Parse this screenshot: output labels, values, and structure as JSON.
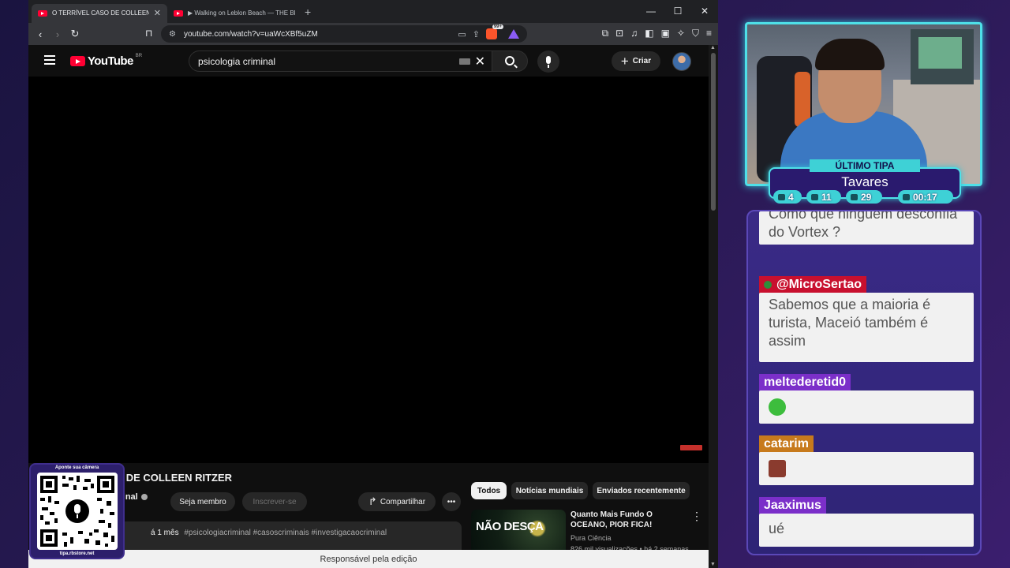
{
  "browser": {
    "tabs": [
      {
        "title": "O TERRÍVEL CASO DE COLLEEN RITZER",
        "active": true
      },
      {
        "title": "▶ Walking on Leblon Beach — THE BEST BE",
        "active": false
      }
    ],
    "url": "youtube.com/watch?v=uaWcXBf5uZM",
    "status_text": "Responsável pela edição"
  },
  "youtube": {
    "logo_text": "YouTube",
    "country": "BR",
    "search_value": "psicologia criminal",
    "create_label": "Criar",
    "video_title": "O DE COLLEEN RITZER",
    "channel_name": "minal",
    "member_button": "Seja membro",
    "subscribe_button": "Inscrever-se",
    "share_button": "Compartilhar",
    "more_button": "•••",
    "description_age": "á 1 mês",
    "description_tags": "#psicologiacriminal #casoscriminais #investigacaocriminal",
    "chips": [
      "Todos",
      "Notícias mundiais",
      "Enviados recentemente"
    ],
    "recommended": {
      "title": "Quanto Mais Fundo O OCEANO, PIOR FICA!",
      "channel": "Pura Ciência",
      "meta": "826 mil visualizações • há 2 semanas",
      "thumb_text": "NÃO DESÇA"
    }
  },
  "qr": {
    "top_label": "Aponte sua câmera",
    "bottom_label": "tipa.rbstore.net"
  },
  "overlay": {
    "tipa_label": "ÚLTIMO TIPA",
    "tipa_name": "Tavares",
    "stats": [
      {
        "icon": "chat-icon",
        "value": "4"
      },
      {
        "icon": "youtube-icon",
        "value": "11"
      },
      {
        "icon": "link-icon",
        "value": "29"
      },
      {
        "icon": "clock-icon",
        "value": "00:17"
      }
    ]
  },
  "chat": {
    "messages": [
      {
        "user": "",
        "text": "Como que ninguém desconfia do Vortex ?",
        "color": "#f1f1f1"
      },
      {
        "user": "@MicroSertao",
        "text": "Sabemos que a maioria é turista, Maceió também é assim",
        "color": "#c8102e"
      },
      {
        "user": "meltederetid0",
        "text": "",
        "emote": "green-frog-emote",
        "color": "#7b2fc9"
      },
      {
        "user": "catarim",
        "text": "",
        "emote": "portrait-emote",
        "color": "#c77a1c"
      },
      {
        "user": "Jaaximus",
        "text": "ué",
        "color": "#7b2fc9"
      }
    ]
  },
  "colors": {
    "accent_cyan": "#4ee0e8",
    "youtube_red": "#ff0033"
  }
}
